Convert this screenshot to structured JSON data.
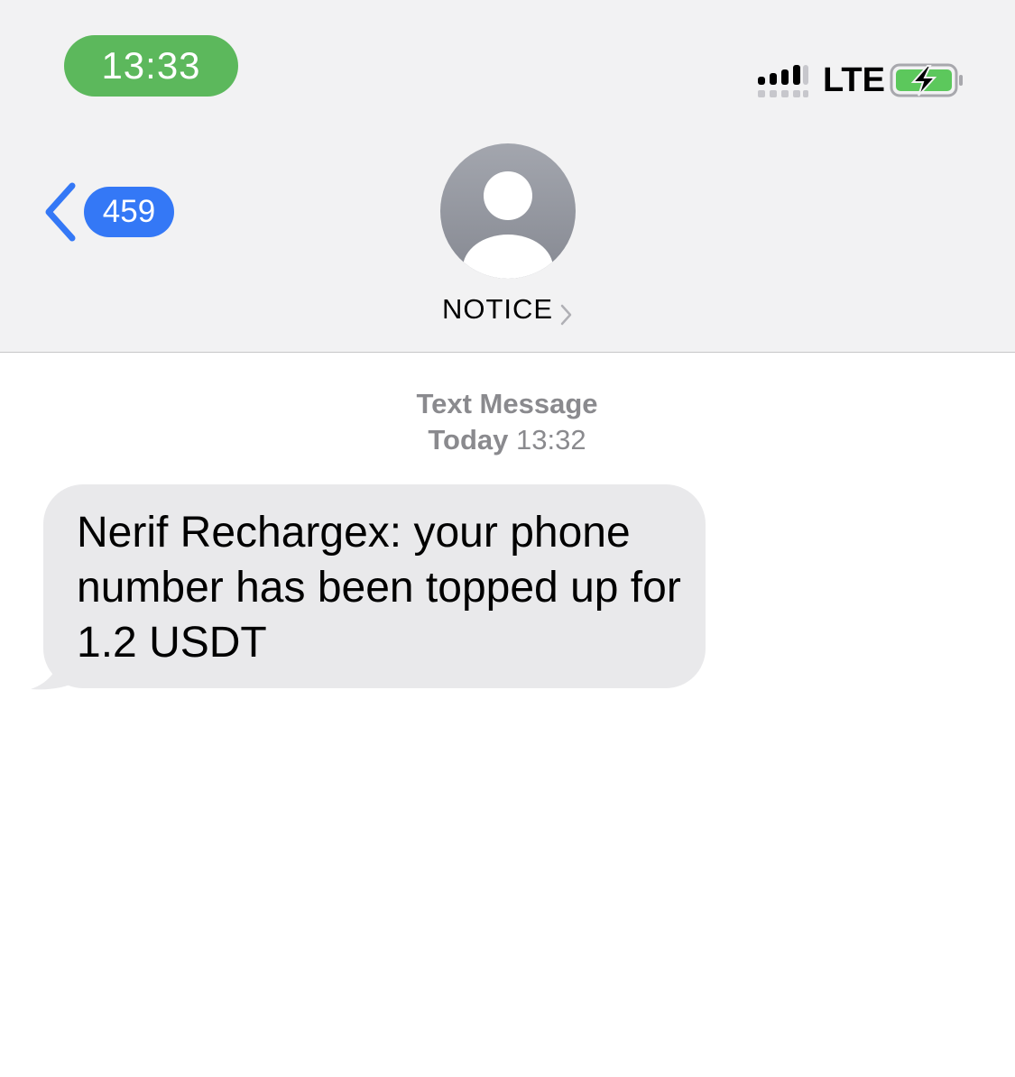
{
  "status_bar": {
    "time": "13:33",
    "network": "LTE",
    "signal_icon": "signal-bars-icon",
    "battery_icon": "battery-charging-icon",
    "time_pill_color": "#5cb85c",
    "battery_color": "#5cc85c"
  },
  "nav": {
    "back_icon": "chevron-left-icon",
    "unread_count": "459",
    "accent_color": "#3478f6",
    "contact_name": "NOTICE",
    "contact_icon": "person-avatar-icon",
    "contact_chevron_icon": "chevron-right-icon"
  },
  "conversation": {
    "message_type": "Text Message",
    "timestamp_day": "Today",
    "timestamp_time": "13:32",
    "messages": [
      {
        "direction": "incoming",
        "text": "Nerif Rechargex: your phone number has been topped up for 1.2 USDT",
        "bubble_color": "#e9e9eb"
      }
    ]
  }
}
